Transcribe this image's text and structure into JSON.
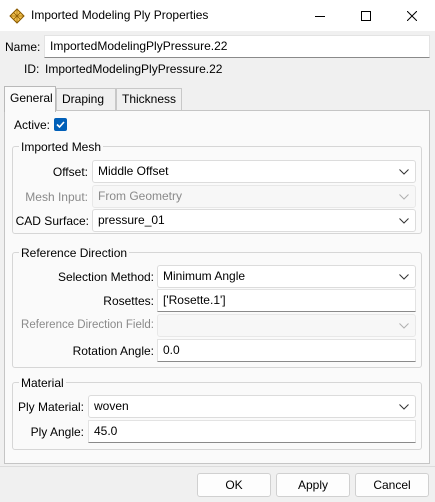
{
  "window": {
    "title": "Imported Modeling Ply Properties",
    "name_label": "Name:",
    "name_value": "ImportedModelingPlyPressure.22",
    "id_label": "ID:",
    "id_value": "ImportedModelingPlyPressure.22"
  },
  "tabs": [
    {
      "label": "General"
    },
    {
      "label": "Draping"
    },
    {
      "label": "Thickness"
    }
  ],
  "general": {
    "active_label": "Active:",
    "active_checked": true,
    "imported_mesh": {
      "title": "Imported Mesh",
      "offset_label": "Offset:",
      "offset_value": "Middle Offset",
      "mesh_input_label": "Mesh Input:",
      "mesh_input_value": "From Geometry",
      "cad_surface_label": "CAD Surface:",
      "cad_surface_value": "pressure_01"
    },
    "reference_direction": {
      "title": "Reference Direction",
      "selection_method_label": "Selection Method:",
      "selection_method_value": "Minimum Angle",
      "rosettes_label": "Rosettes:",
      "rosettes_value": "['Rosette.1']",
      "ref_dir_field_label": "Reference Direction Field:",
      "ref_dir_field_value": "",
      "rotation_angle_label": "Rotation Angle:",
      "rotation_angle_value": "0.0"
    },
    "material": {
      "title": "Material",
      "ply_material_label": "Ply Material:",
      "ply_material_value": "woven",
      "ply_angle_label": "Ply Angle:",
      "ply_angle_value": "45.0"
    }
  },
  "buttons": {
    "ok": "OK",
    "apply": "Apply",
    "cancel": "Cancel"
  },
  "colors": {
    "accent": "#005fb8"
  }
}
